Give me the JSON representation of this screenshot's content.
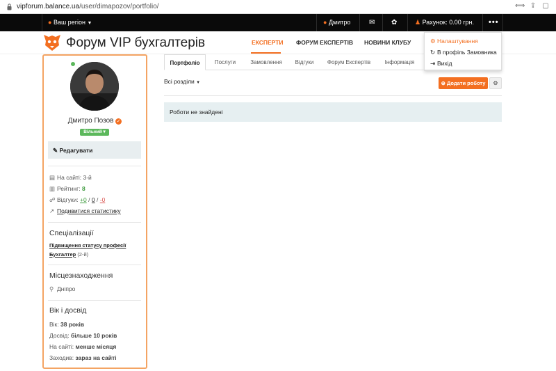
{
  "browser": {
    "url_host": "vipforum.balance.ua",
    "url_path": "/user/dimapozov/portfolio/",
    "icons": [
      "lock-icon",
      "translate-icon",
      "share-icon",
      "extensions-icon"
    ]
  },
  "topnav": {
    "region_label": "Ваш регіон",
    "user_label": "Дмитро",
    "account_label": "Рахунок: 0.00 грн.",
    "icons": [
      "map-pin-icon",
      "user-icon",
      "mail-icon",
      "handshake-icon",
      "account-icon",
      "more-icon"
    ]
  },
  "header": {
    "site_title": "Форум VIP бухгалтерів",
    "nav": [
      {
        "label": "ЕКСПЕРТИ",
        "active": true
      },
      {
        "label": "ФОРУМ ЕКСПЕРТІВ",
        "active": false
      },
      {
        "label": "НОВИНИ КЛУБУ",
        "active": false
      }
    ]
  },
  "dropdown": {
    "items": [
      {
        "label": "Налаштування",
        "icon": "cogs-icon",
        "highlight": true
      },
      {
        "label": "В профіль Замовника",
        "icon": "refresh-icon",
        "highlight": false
      },
      {
        "label": "Вихід",
        "icon": "logout-icon",
        "highlight": false
      }
    ]
  },
  "profile": {
    "name": "Дмитро Позов",
    "status": "Вільний",
    "edit_label": "Редагувати",
    "on_site_label": "На сайті:",
    "on_site_value": "3-й",
    "rating_label": "Рейтинг:",
    "rating_value": "8",
    "reviews_label": "Відгуки:",
    "reviews_positive": "+0",
    "reviews_neutral": "0",
    "reviews_negative": "-0",
    "review_sep": "/",
    "stats_link": "Подивитися статистику",
    "specializations_title": "Спеціалізації",
    "specialization_link_1": "Підвищення статусу професії",
    "specialization_link_2": "Бухгалтер",
    "specialization_rank": "(2-й)",
    "location_title": "Місцезнаходження",
    "location_value": "Дніпро",
    "age_title": "Вік і досвід",
    "age_label": "Вік:",
    "age_value": "38 років",
    "experience_label": "Досвід:",
    "experience_value": "більше 10 років",
    "member_label": "На сайті:",
    "member_value": "менше місяця",
    "visits_label": "Заходив:",
    "visits_value": "зараз на сайті",
    "accent_color": "#f36f21",
    "online_color": "#5cb85c"
  },
  "tabs": [
    {
      "label": "Портфоліо",
      "active": true
    },
    {
      "label": "Послуги",
      "active": false
    },
    {
      "label": "Замовлення",
      "active": false
    },
    {
      "label": "Відгуки",
      "active": false
    },
    {
      "label": "Форум Експертів",
      "active": false
    },
    {
      "label": "Інформація",
      "active": false
    }
  ],
  "content": {
    "filter_label": "Всі розділи",
    "add_button_label": "Додати роботу",
    "empty_message": "Роботи не знайдені"
  }
}
